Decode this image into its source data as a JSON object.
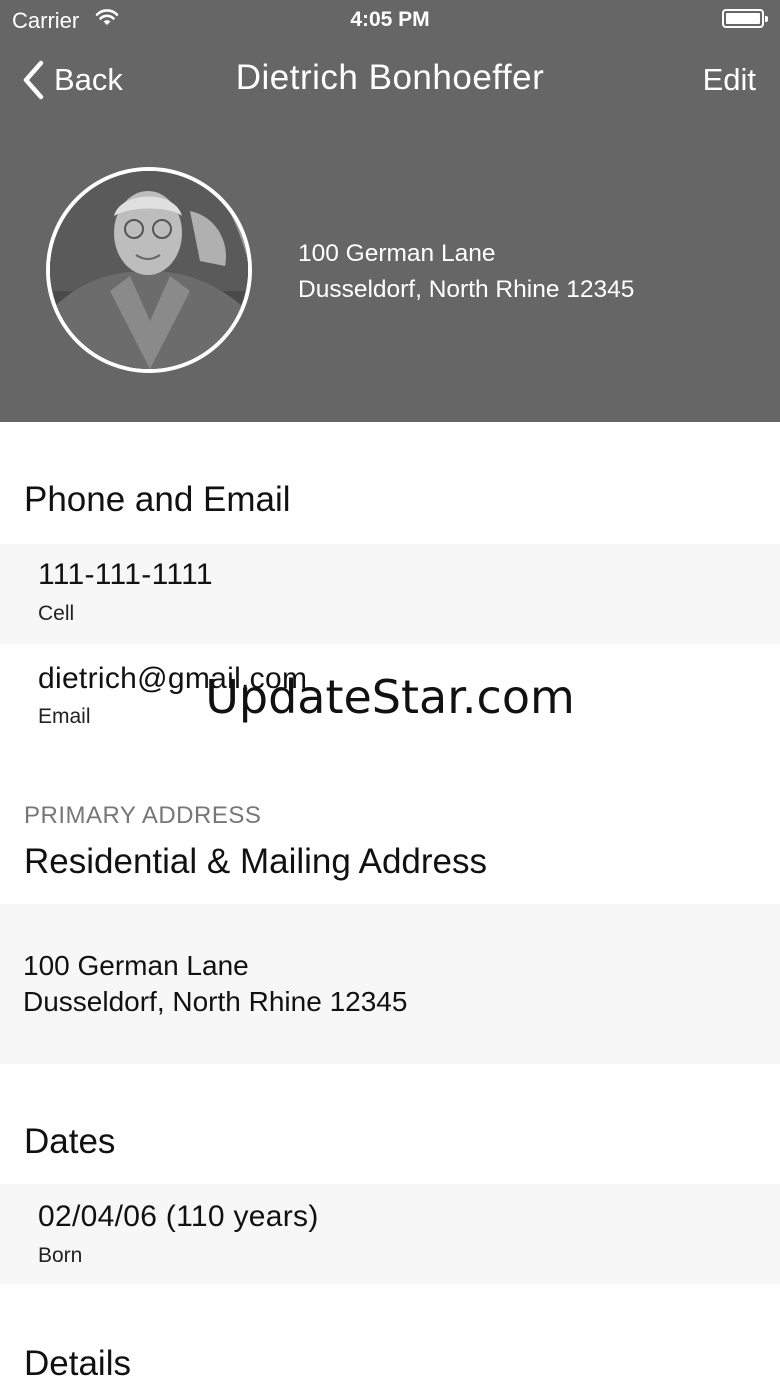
{
  "status_bar": {
    "carrier": "Carrier",
    "time": "4:05 PM"
  },
  "nav": {
    "back_label": "Back",
    "title": "Dietrich Bonhoeffer",
    "edit_label": "Edit"
  },
  "header": {
    "address_line1": "100 German Lane",
    "address_line2": "Dusseldorf, North Rhine 12345"
  },
  "phone_email": {
    "title": "Phone and Email",
    "items": [
      {
        "value": "111-111-1111",
        "label": "Cell"
      },
      {
        "value": "dietrich@gmail.com",
        "label": "Email"
      }
    ]
  },
  "address": {
    "caption": "PRIMARY ADDRESS",
    "title": "Residential & Mailing Address",
    "line1": "100 German Lane",
    "line2": "Dusseldorf, North Rhine 12345"
  },
  "dates": {
    "title": "Dates",
    "items": [
      {
        "value": "02/04/06 (110 years)",
        "label": "Born"
      }
    ]
  },
  "details": {
    "title": "Details"
  },
  "watermark": "UpdateStar.com",
  "colors": {
    "header_bg": "#666666",
    "row_alt_bg": "#f7f7f7",
    "text": "#111111",
    "caption": "#777777"
  }
}
